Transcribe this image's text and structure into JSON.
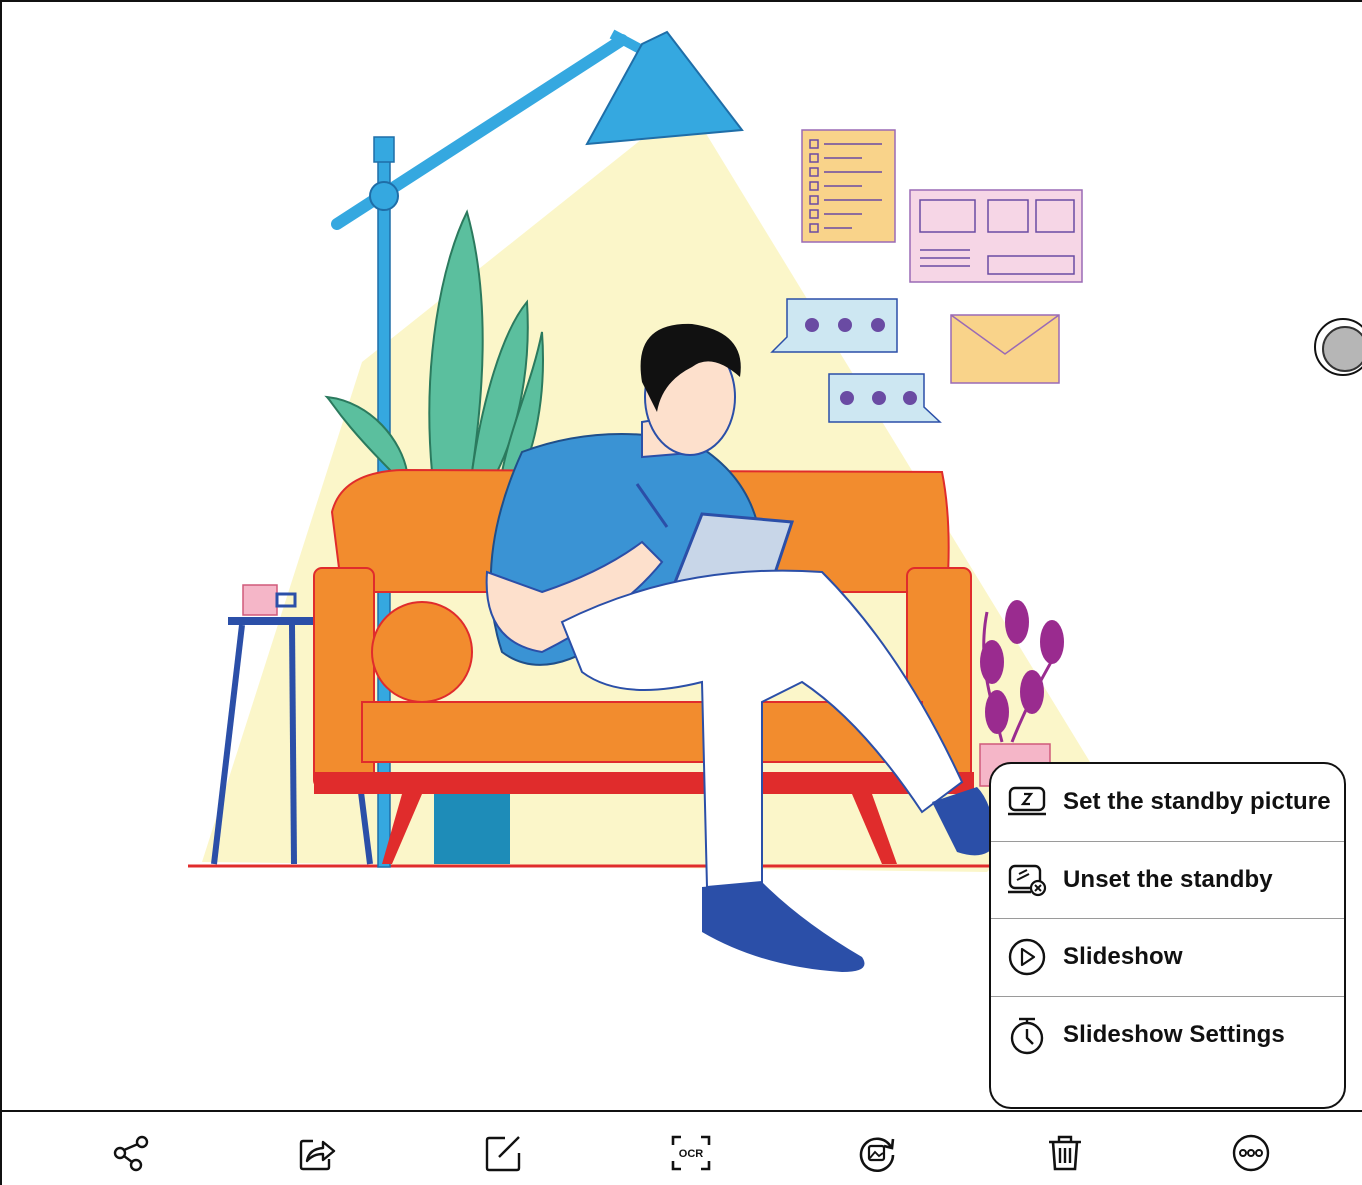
{
  "menu": {
    "items": [
      {
        "label": "Set the standby picture",
        "icon": "standby-picture-icon"
      },
      {
        "label": "Unset the standby",
        "icon": "unset-standby-icon"
      },
      {
        "label": "Slideshow",
        "icon": "play-icon"
      },
      {
        "label": "Slideshow Settings",
        "icon": "timer-icon"
      }
    ]
  },
  "toolbar": {
    "items": [
      {
        "name": "share",
        "icon": "share-icon"
      },
      {
        "name": "send",
        "icon": "send-icon"
      },
      {
        "name": "edit",
        "icon": "edit-icon"
      },
      {
        "name": "ocr",
        "icon": "ocr-icon",
        "label": "OCR"
      },
      {
        "name": "rotate",
        "icon": "rotate-image-icon"
      },
      {
        "name": "delete",
        "icon": "trash-icon"
      },
      {
        "name": "more",
        "icon": "more-icon"
      }
    ]
  },
  "colors": {
    "lamp": "#35a8e0",
    "sofa": "#f28c2e",
    "sofa_outline": "#e02c2c",
    "shirt": "#3a93d4",
    "shoes": "#2b4fa8",
    "light_cone": "#fbf6c9",
    "plant": "#5bbf9e",
    "plant_right": "#9a2b8f",
    "bubble": "#cde7f2",
    "dots": "#6a4ba3",
    "note": "#f9d38a",
    "panel": "#f6d6e6"
  }
}
